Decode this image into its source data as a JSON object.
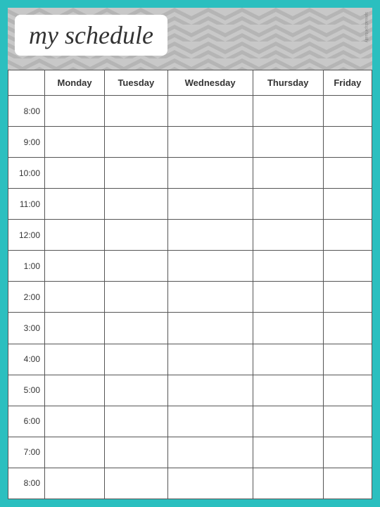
{
  "header": {
    "title": "my schedule",
    "watermark": "spreadspiritually"
  },
  "days": [
    "",
    "Monday",
    "Tuesday",
    "Wednesday",
    "Thursday",
    "Friday"
  ],
  "times": [
    "8:00",
    "9:00",
    "10:00",
    "11:00",
    "12:00",
    "1:00",
    "2:00",
    "3:00",
    "4:00",
    "5:00",
    "6:00",
    "7:00",
    "8:00"
  ],
  "colors": {
    "teal": "#2bbfbf",
    "chevron_light": "#d9d9d9",
    "chevron_dark": "#aaaaaa"
  }
}
